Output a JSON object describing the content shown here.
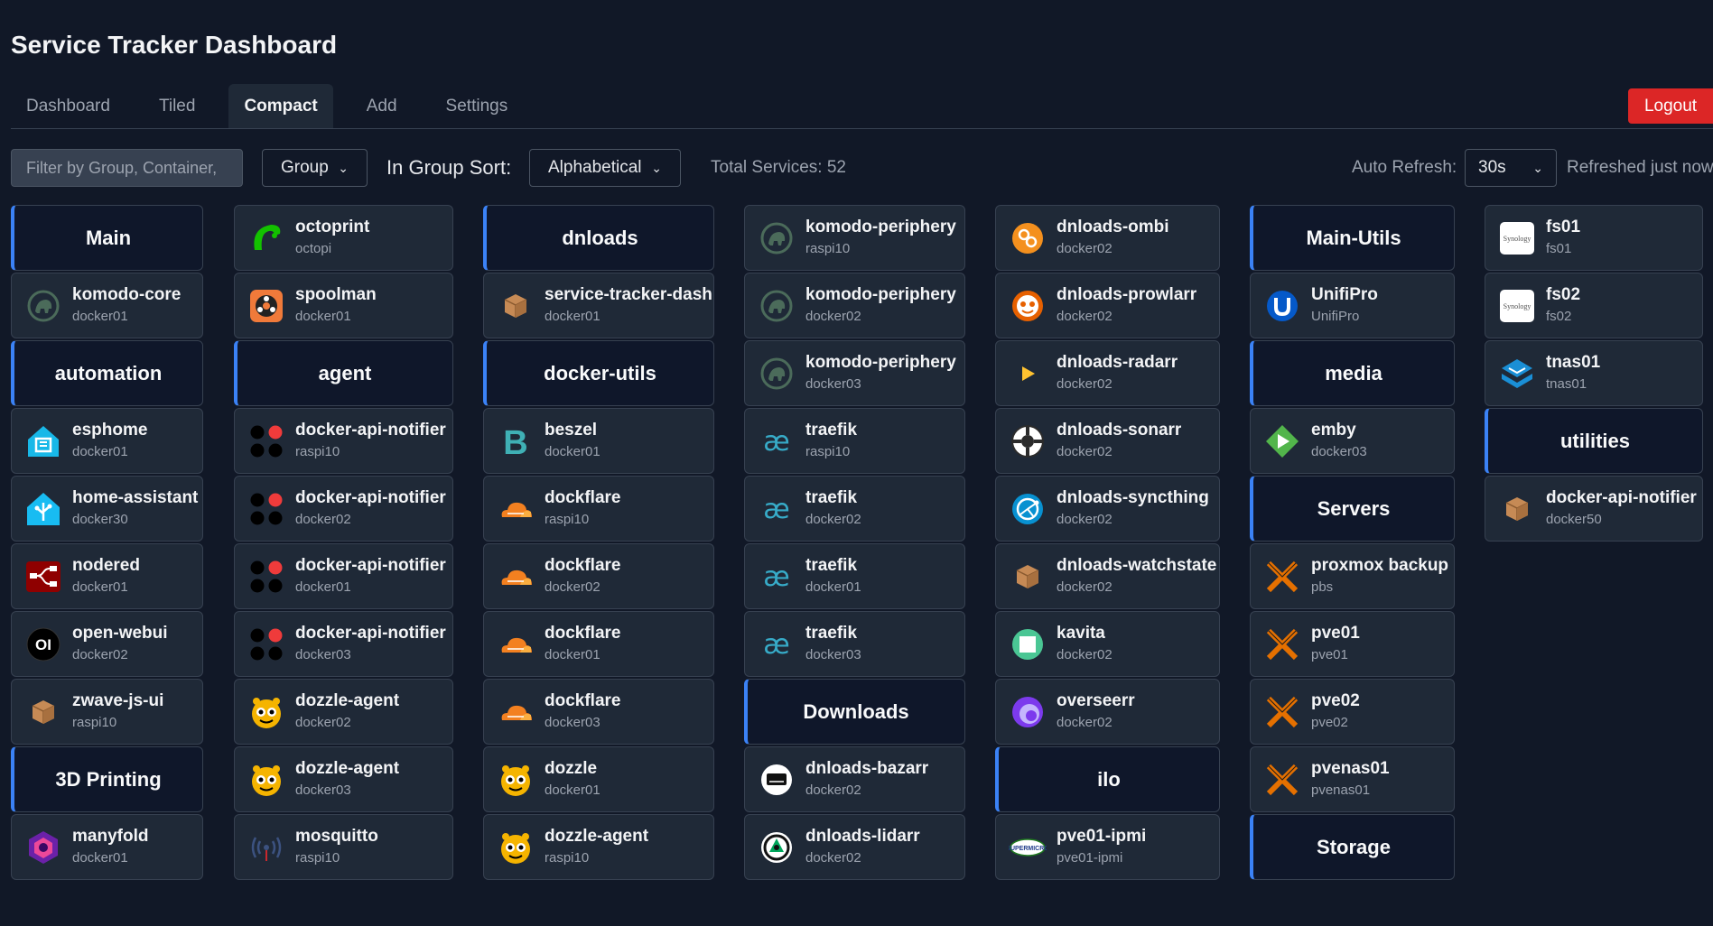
{
  "app": {
    "title": "Service Tracker Dashboard"
  },
  "nav": {
    "tabs": [
      "Dashboard",
      "Tiled",
      "Compact",
      "Add",
      "Settings"
    ],
    "active": "Compact",
    "logout_label": "Logout"
  },
  "controls": {
    "filter_placeholder": "Filter by Group, Container, ...",
    "filter_visible_text": "Filter by Group, Container,",
    "group_by_value": "Group",
    "sort_label": "In Group Sort:",
    "sort_value": "Alphabetical",
    "total_services": "Total Services: 52",
    "auto_refresh_label": "Auto Refresh:",
    "auto_refresh_value": "30s",
    "refreshed_status": "Refreshed just now"
  },
  "columns": [
    [
      {
        "type": "group",
        "name": "Main"
      },
      {
        "type": "service",
        "name": "komodo-core",
        "host": "docker01",
        "icon": "komodo-icon"
      },
      {
        "type": "group",
        "name": "automation"
      },
      {
        "type": "service",
        "name": "esphome",
        "host": "docker01",
        "icon": "esphome-icon"
      },
      {
        "type": "service",
        "name": "home-assistant",
        "host": "docker30",
        "icon": "home-assistant-icon"
      },
      {
        "type": "service",
        "name": "nodered",
        "host": "docker01",
        "icon": "nodered-icon"
      },
      {
        "type": "service",
        "name": "open-webui",
        "host": "docker02",
        "icon": "open-webui-icon"
      },
      {
        "type": "service",
        "name": "zwave-js-ui",
        "host": "raspi10",
        "icon": "box-icon"
      },
      {
        "type": "group",
        "name": "3D Printing"
      },
      {
        "type": "service",
        "name": "manyfold",
        "host": "docker01",
        "icon": "manyfold-icon"
      }
    ],
    [
      {
        "type": "service",
        "name": "octoprint",
        "host": "octopi",
        "icon": "octoprint-icon"
      },
      {
        "type": "service",
        "name": "spoolman",
        "host": "docker01",
        "icon": "spoolman-icon"
      },
      {
        "type": "group",
        "name": "agent"
      },
      {
        "type": "service",
        "name": "docker-api-notifier",
        "host": "raspi10",
        "icon": "notifier-dots-icon"
      },
      {
        "type": "service",
        "name": "docker-api-notifier",
        "host": "docker02",
        "icon": "notifier-dots-icon"
      },
      {
        "type": "service",
        "name": "docker-api-notifier",
        "host": "docker01",
        "icon": "notifier-dots-icon"
      },
      {
        "type": "service",
        "name": "docker-api-notifier",
        "host": "docker03",
        "icon": "notifier-dots-icon"
      },
      {
        "type": "service",
        "name": "dozzle-agent",
        "host": "docker02",
        "icon": "dozzle-icon"
      },
      {
        "type": "service",
        "name": "dozzle-agent",
        "host": "docker03",
        "icon": "dozzle-icon"
      },
      {
        "type": "service",
        "name": "mosquitto",
        "host": "raspi10",
        "icon": "mosquitto-icon"
      }
    ],
    [
      {
        "type": "group",
        "name": "dnloads"
      },
      {
        "type": "service",
        "name": "service-tracker-dash",
        "host": "docker01",
        "icon": "box-icon"
      },
      {
        "type": "group",
        "name": "docker-utils"
      },
      {
        "type": "service",
        "name": "beszel",
        "host": "docker01",
        "icon": "beszel-icon"
      },
      {
        "type": "service",
        "name": "dockflare",
        "host": "raspi10",
        "icon": "cloudflare-icon"
      },
      {
        "type": "service",
        "name": "dockflare",
        "host": "docker02",
        "icon": "cloudflare-icon"
      },
      {
        "type": "service",
        "name": "dockflare",
        "host": "docker01",
        "icon": "cloudflare-icon"
      },
      {
        "type": "service",
        "name": "dockflare",
        "host": "docker03",
        "icon": "cloudflare-icon"
      },
      {
        "type": "service",
        "name": "dozzle",
        "host": "docker01",
        "icon": "dozzle-icon"
      },
      {
        "type": "service",
        "name": "dozzle-agent",
        "host": "raspi10",
        "icon": "dozzle-icon"
      }
    ],
    [
      {
        "type": "service",
        "name": "komodo-periphery",
        "host": "raspi10",
        "icon": "komodo-icon"
      },
      {
        "type": "service",
        "name": "komodo-periphery",
        "host": "docker02",
        "icon": "komodo-icon"
      },
      {
        "type": "service",
        "name": "komodo-periphery",
        "host": "docker03",
        "icon": "komodo-icon"
      },
      {
        "type": "service",
        "name": "traefik",
        "host": "raspi10",
        "icon": "traefik-icon"
      },
      {
        "type": "service",
        "name": "traefik",
        "host": "docker02",
        "icon": "traefik-icon"
      },
      {
        "type": "service",
        "name": "traefik",
        "host": "docker01",
        "icon": "traefik-icon"
      },
      {
        "type": "service",
        "name": "traefik",
        "host": "docker03",
        "icon": "traefik-icon"
      },
      {
        "type": "group",
        "name": "Downloads"
      },
      {
        "type": "service",
        "name": "dnloads-bazarr",
        "host": "docker02",
        "icon": "bazarr-icon"
      },
      {
        "type": "service",
        "name": "dnloads-lidarr",
        "host": "docker02",
        "icon": "lidarr-icon"
      }
    ],
    [
      {
        "type": "service",
        "name": "dnloads-ombi",
        "host": "docker02",
        "icon": "ombi-icon"
      },
      {
        "type": "service",
        "name": "dnloads-prowlarr",
        "host": "docker02",
        "icon": "prowlarr-icon"
      },
      {
        "type": "service",
        "name": "dnloads-radarr",
        "host": "docker02",
        "icon": "radarr-icon"
      },
      {
        "type": "service",
        "name": "dnloads-sonarr",
        "host": "docker02",
        "icon": "sonarr-icon"
      },
      {
        "type": "service",
        "name": "dnloads-syncthing",
        "host": "docker02",
        "icon": "syncthing-icon"
      },
      {
        "type": "service",
        "name": "dnloads-watchstate",
        "host": "docker02",
        "icon": "box-icon"
      },
      {
        "type": "service",
        "name": "kavita",
        "host": "docker02",
        "icon": "kavita-icon"
      },
      {
        "type": "service",
        "name": "overseerr",
        "host": "docker02",
        "icon": "overseerr-icon"
      },
      {
        "type": "group",
        "name": "ilo"
      },
      {
        "type": "service",
        "name": "pve01-ipmi",
        "host": "pve01-ipmi",
        "icon": "supermicro-icon"
      }
    ],
    [
      {
        "type": "group",
        "name": "Main-Utils"
      },
      {
        "type": "service",
        "name": "UnifiPro",
        "host": "UnifiPro",
        "icon": "unifi-icon"
      },
      {
        "type": "group",
        "name": "media"
      },
      {
        "type": "service",
        "name": "emby",
        "host": "docker03",
        "icon": "emby-icon"
      },
      {
        "type": "group",
        "name": "Servers"
      },
      {
        "type": "service",
        "name": "proxmox backup",
        "host": "pbs",
        "icon": "proxmox-icon"
      },
      {
        "type": "service",
        "name": "pve01",
        "host": "pve01",
        "icon": "proxmox-icon"
      },
      {
        "type": "service",
        "name": "pve02",
        "host": "pve02",
        "icon": "proxmox-icon"
      },
      {
        "type": "service",
        "name": "pvenas01",
        "host": "pvenas01",
        "icon": "proxmox-icon"
      },
      {
        "type": "group",
        "name": "Storage"
      }
    ],
    [
      {
        "type": "service",
        "name": "fs01",
        "host": "fs01",
        "icon": "synology-icon"
      },
      {
        "type": "service",
        "name": "fs02",
        "host": "fs02",
        "icon": "synology-icon"
      },
      {
        "type": "service",
        "name": "tnas01",
        "host": "tnas01",
        "icon": "tnas-icon"
      },
      {
        "type": "group",
        "name": "utilities"
      },
      {
        "type": "service",
        "name": "docker-api-notifier",
        "host": "docker50",
        "icon": "box-icon"
      }
    ]
  ],
  "icon_text": {
    "synology": "Synology",
    "supermicro": "SUPERMICRO",
    "openwebui": "OI"
  },
  "colors": {
    "background": "#111827",
    "card": "#1f2937",
    "group_accent": "#3b82f6",
    "logout": "#dc2626"
  }
}
